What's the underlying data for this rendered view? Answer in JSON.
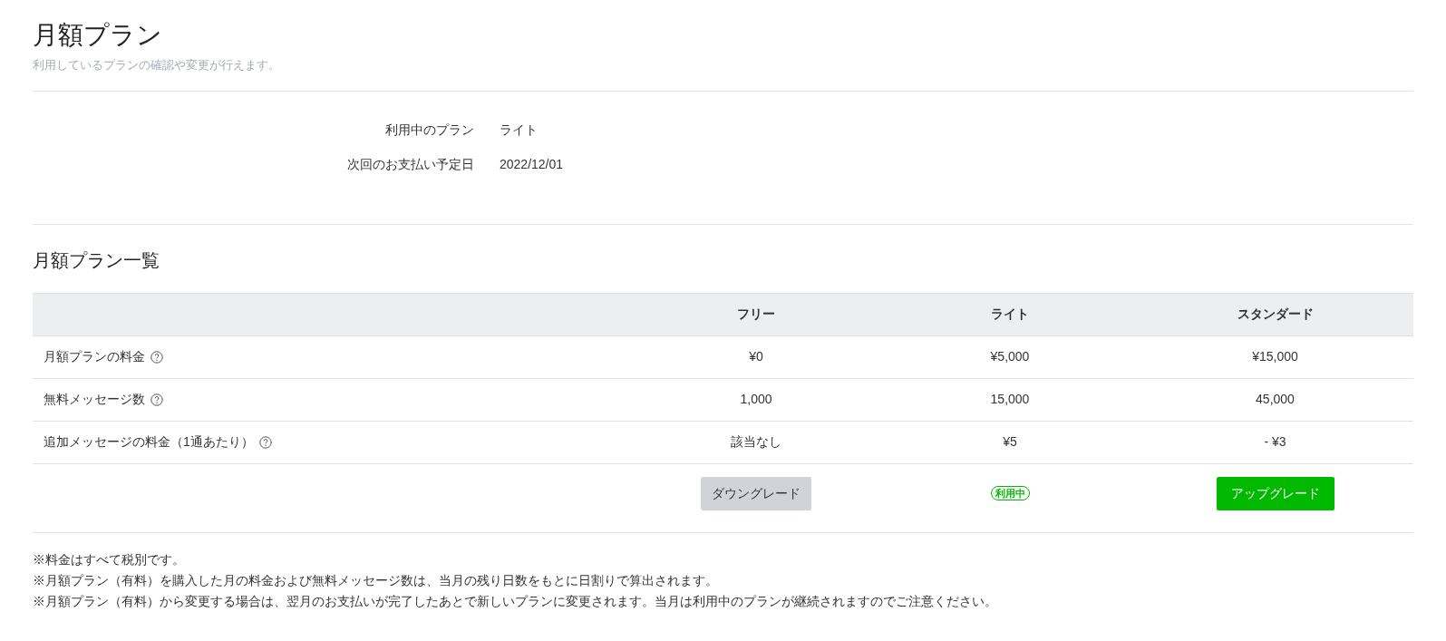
{
  "header": {
    "title": "月額プラン",
    "subtitle": "利用しているプランの確認や変更が行えます。"
  },
  "current_plan": [
    {
      "label": "利用中のプラン",
      "value": "ライト"
    },
    {
      "label": "次回のお支払い予定日",
      "value": "2022/12/01"
    }
  ],
  "plan_list": {
    "title": "月額プラン一覧",
    "columns": [
      "フリー",
      "ライト",
      "スタンダード"
    ],
    "rows": [
      {
        "label": "月額プランの料金",
        "help": true,
        "cells": [
          "¥0",
          "¥5,000",
          "¥15,000"
        ]
      },
      {
        "label": "無料メッセージ数",
        "help": true,
        "cells": [
          "1,000",
          "15,000",
          "45,000"
        ]
      },
      {
        "label": "追加メッセージの料金（1通あたり）",
        "help": true,
        "cells": [
          "該当なし",
          "¥5",
          "- ¥3"
        ]
      }
    ],
    "actions": [
      {
        "kind": "downgrade",
        "label": "ダウングレード"
      },
      {
        "kind": "current",
        "label": "利用中"
      },
      {
        "kind": "upgrade",
        "label": "アップグレード"
      }
    ]
  },
  "notes": [
    "※料金はすべて税別です。",
    "※月額プラン（有料）を購入した月の料金および無料メッセージ数は、当月の残り日数をもとに日割りで算出されます。",
    "※月額プラン（有料）から変更する場合は、翌月のお支払いが完了したあとで新しいプランに変更されます。当月は利用中のプランが継続されますのでご注意ください。"
  ]
}
